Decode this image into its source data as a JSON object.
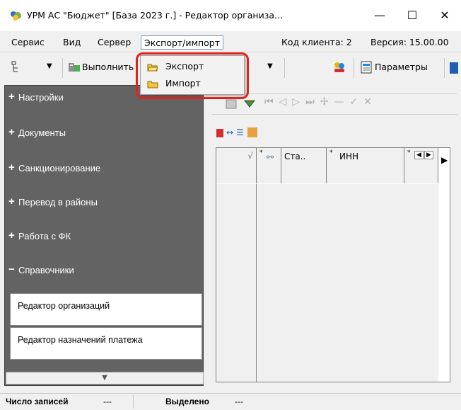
{
  "window": {
    "title": "УРМ АС \"Бюджет\" [База 2023 г.] - Редактор организа...",
    "minimize_glyph": "—",
    "maximize_glyph": "☐",
    "close_glyph": "✕"
  },
  "menu": {
    "items": [
      "Сервис",
      "Вид",
      "Сервер",
      "Экспорт/импорт"
    ],
    "client_code": "Код клиента: 2",
    "version": "Версия: 15.00.00"
  },
  "toolbar": {
    "execute_label": "Выполнить",
    "params_label": "Параметры"
  },
  "dropdown": {
    "items": [
      {
        "label": "Экспорт",
        "icon": "folder-open-icon"
      },
      {
        "label": "Импорт",
        "icon": "folder-icon"
      }
    ]
  },
  "nav": {
    "sections": [
      {
        "sign": "+",
        "label": "Настройки"
      },
      {
        "sign": "+",
        "label": "Документы"
      },
      {
        "sign": "+",
        "label": "Санкционирование"
      },
      {
        "sign": "+",
        "label": "Перевод в районы"
      },
      {
        "sign": "+",
        "label": "Работа с ФК"
      },
      {
        "sign": "−",
        "label": "Справочники"
      }
    ],
    "subitems": [
      "Редактор организаций",
      "Редактор назначений платежа"
    ]
  },
  "grid": {
    "columns": [
      "Ста..",
      "ИНН"
    ]
  },
  "statusbar": {
    "records_label": "Число записей",
    "records_value": "---",
    "selected_label": "Выделено",
    "selected_value": "---"
  },
  "colors": {
    "nav_bg": "#636363",
    "highlight": "#e2231a"
  }
}
